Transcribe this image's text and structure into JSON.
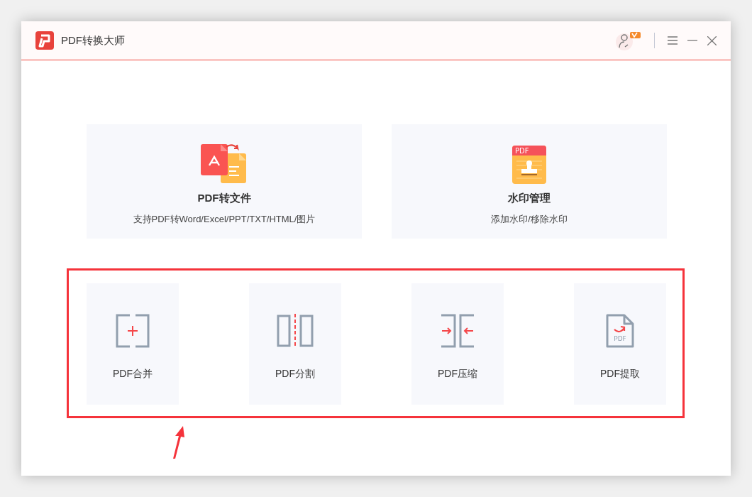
{
  "window": {
    "title": "PDF转换大师"
  },
  "feature_cards": [
    {
      "kind": "convert",
      "title": "PDF转文件",
      "subtitle": "支持PDF转Word/Excel/PPT/TXT/HTML/图片"
    },
    {
      "kind": "watermark",
      "title": "水印管理",
      "subtitle": "添加水印/移除水印",
      "icon_text": "PDF"
    }
  ],
  "tools": [
    {
      "kind": "merge",
      "label": "PDF合并"
    },
    {
      "kind": "split",
      "label": "PDF分割"
    },
    {
      "kind": "compress",
      "label": "PDF压缩"
    },
    {
      "kind": "extract",
      "label": "PDF提取",
      "icon_text": "PDF"
    }
  ]
}
